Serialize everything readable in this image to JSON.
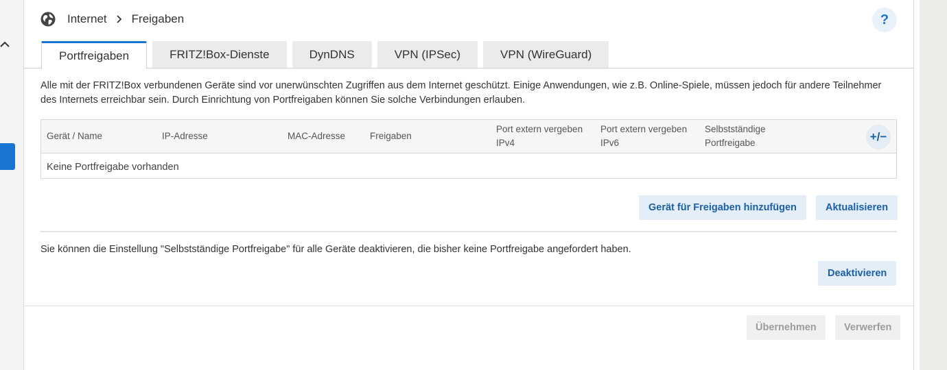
{
  "breadcrumb": {
    "section": "Internet",
    "page": "Freigaben"
  },
  "help": {
    "label": "?"
  },
  "tabs": [
    {
      "label": "Portfreigaben",
      "active": true
    },
    {
      "label": "FRITZ!Box-Dienste",
      "active": false
    },
    {
      "label": "DynDNS",
      "active": false
    },
    {
      "label": "VPN (IPSec)",
      "active": false
    },
    {
      "label": "VPN (WireGuard)",
      "active": false
    }
  ],
  "intro": "Alle mit der FRITZ!Box verbundenen Geräte sind vor unerwünschten Zugriffen aus dem Internet geschützt. Einige Anwendungen, wie z.B. Online-Spiele, müssen jedoch für andere Teilnehmer des Internets erreichbar sein. Durch Einrichtung von Portfreigaben können Sie solche Verbindungen erlauben.",
  "table": {
    "columns": {
      "name": "Gerät / Name",
      "ip": "IP-Adresse",
      "mac": "MAC-Adresse",
      "shares": "Freigaben",
      "port_ipv4_line1": "Port extern vergeben",
      "port_ipv4_line2": "IPv4",
      "port_ipv6_line1": "Port extern vergeben",
      "port_ipv6_line2": "IPv6",
      "self_line1": "Selbstständige",
      "self_line2": "Portfreigabe"
    },
    "toggle_label": "+/−",
    "empty_text": "Keine Portfreigabe vorhanden"
  },
  "actions": {
    "add_device": "Gerät für Freigaben hinzufügen",
    "refresh": "Aktualisieren"
  },
  "self_share": {
    "note": "Sie können die Einstellung \"Selbstständige Portfreigabe\" für alle Geräte deaktivieren, die bisher keine Portfreigabe angefordert haben.",
    "deactivate": "Deaktivieren"
  },
  "footer": {
    "apply": "Übernehmen",
    "discard": "Verwerfen"
  },
  "colors": {
    "accent": "#1a75d2",
    "button_bg": "#e4eef8",
    "disabled_bg": "#f0f0f0"
  }
}
